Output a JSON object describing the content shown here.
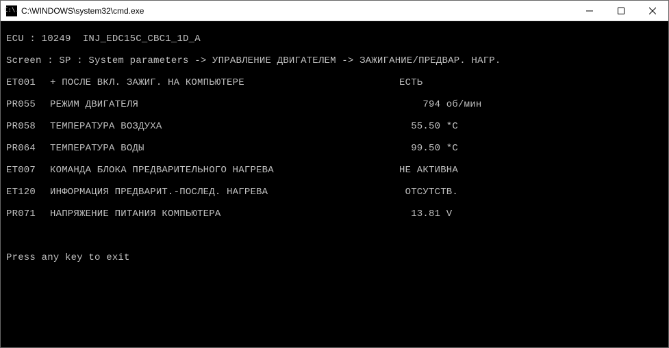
{
  "window": {
    "title": "C:\\WINDOWS\\system32\\cmd.exe",
    "icon_text": "C:\\."
  },
  "console": {
    "ecu_line": "ECU : 10249  INJ_EDC15C_CBC1_1D_A",
    "screen_line": "Screen : SP : System parameters -> УПРАВЛЕНИЕ ДВИГАТЕЛЕМ -> ЗАЖИГАНИЕ/ПРЕДВАР. НАГР.",
    "rows": [
      {
        "code": "ET001",
        "desc": "+ ПОСЛЕ ВКЛ. ЗАЖИГ. НА КОМПЬЮТЕРЕ",
        "value": "ЕСТЬ"
      },
      {
        "code": "PR055",
        "desc": "РЕЖИМ ДВИГАТЕЛЯ",
        "value": "    794 об/мин"
      },
      {
        "code": "PR058",
        "desc": "ТЕМПЕРАТУРА ВОЗДУХА",
        "value": "  55.50 *C"
      },
      {
        "code": "PR064",
        "desc": "ТЕМПЕРАТУРА ВОДЫ",
        "value": "  99.50 *C"
      },
      {
        "code": "ET007",
        "desc": "КОМАНДА БЛОКА ПРЕДВАРИТЕЛЬНОГО НАГРЕВА",
        "value": "НЕ АКТИВНА"
      },
      {
        "code": "ET120",
        "desc": "ИНФОРМАЦИЯ ПРЕДВАРИТ.-ПОСЛЕД. НАГРЕВА",
        "value": " ОТСУТСТВ."
      },
      {
        "code": "PR071",
        "desc": "НАПРЯЖЕНИЕ ПИТАНИЯ КОМПЬЮТЕРА",
        "value": "  13.81 V"
      }
    ],
    "prompt": "Press any key to exit"
  }
}
